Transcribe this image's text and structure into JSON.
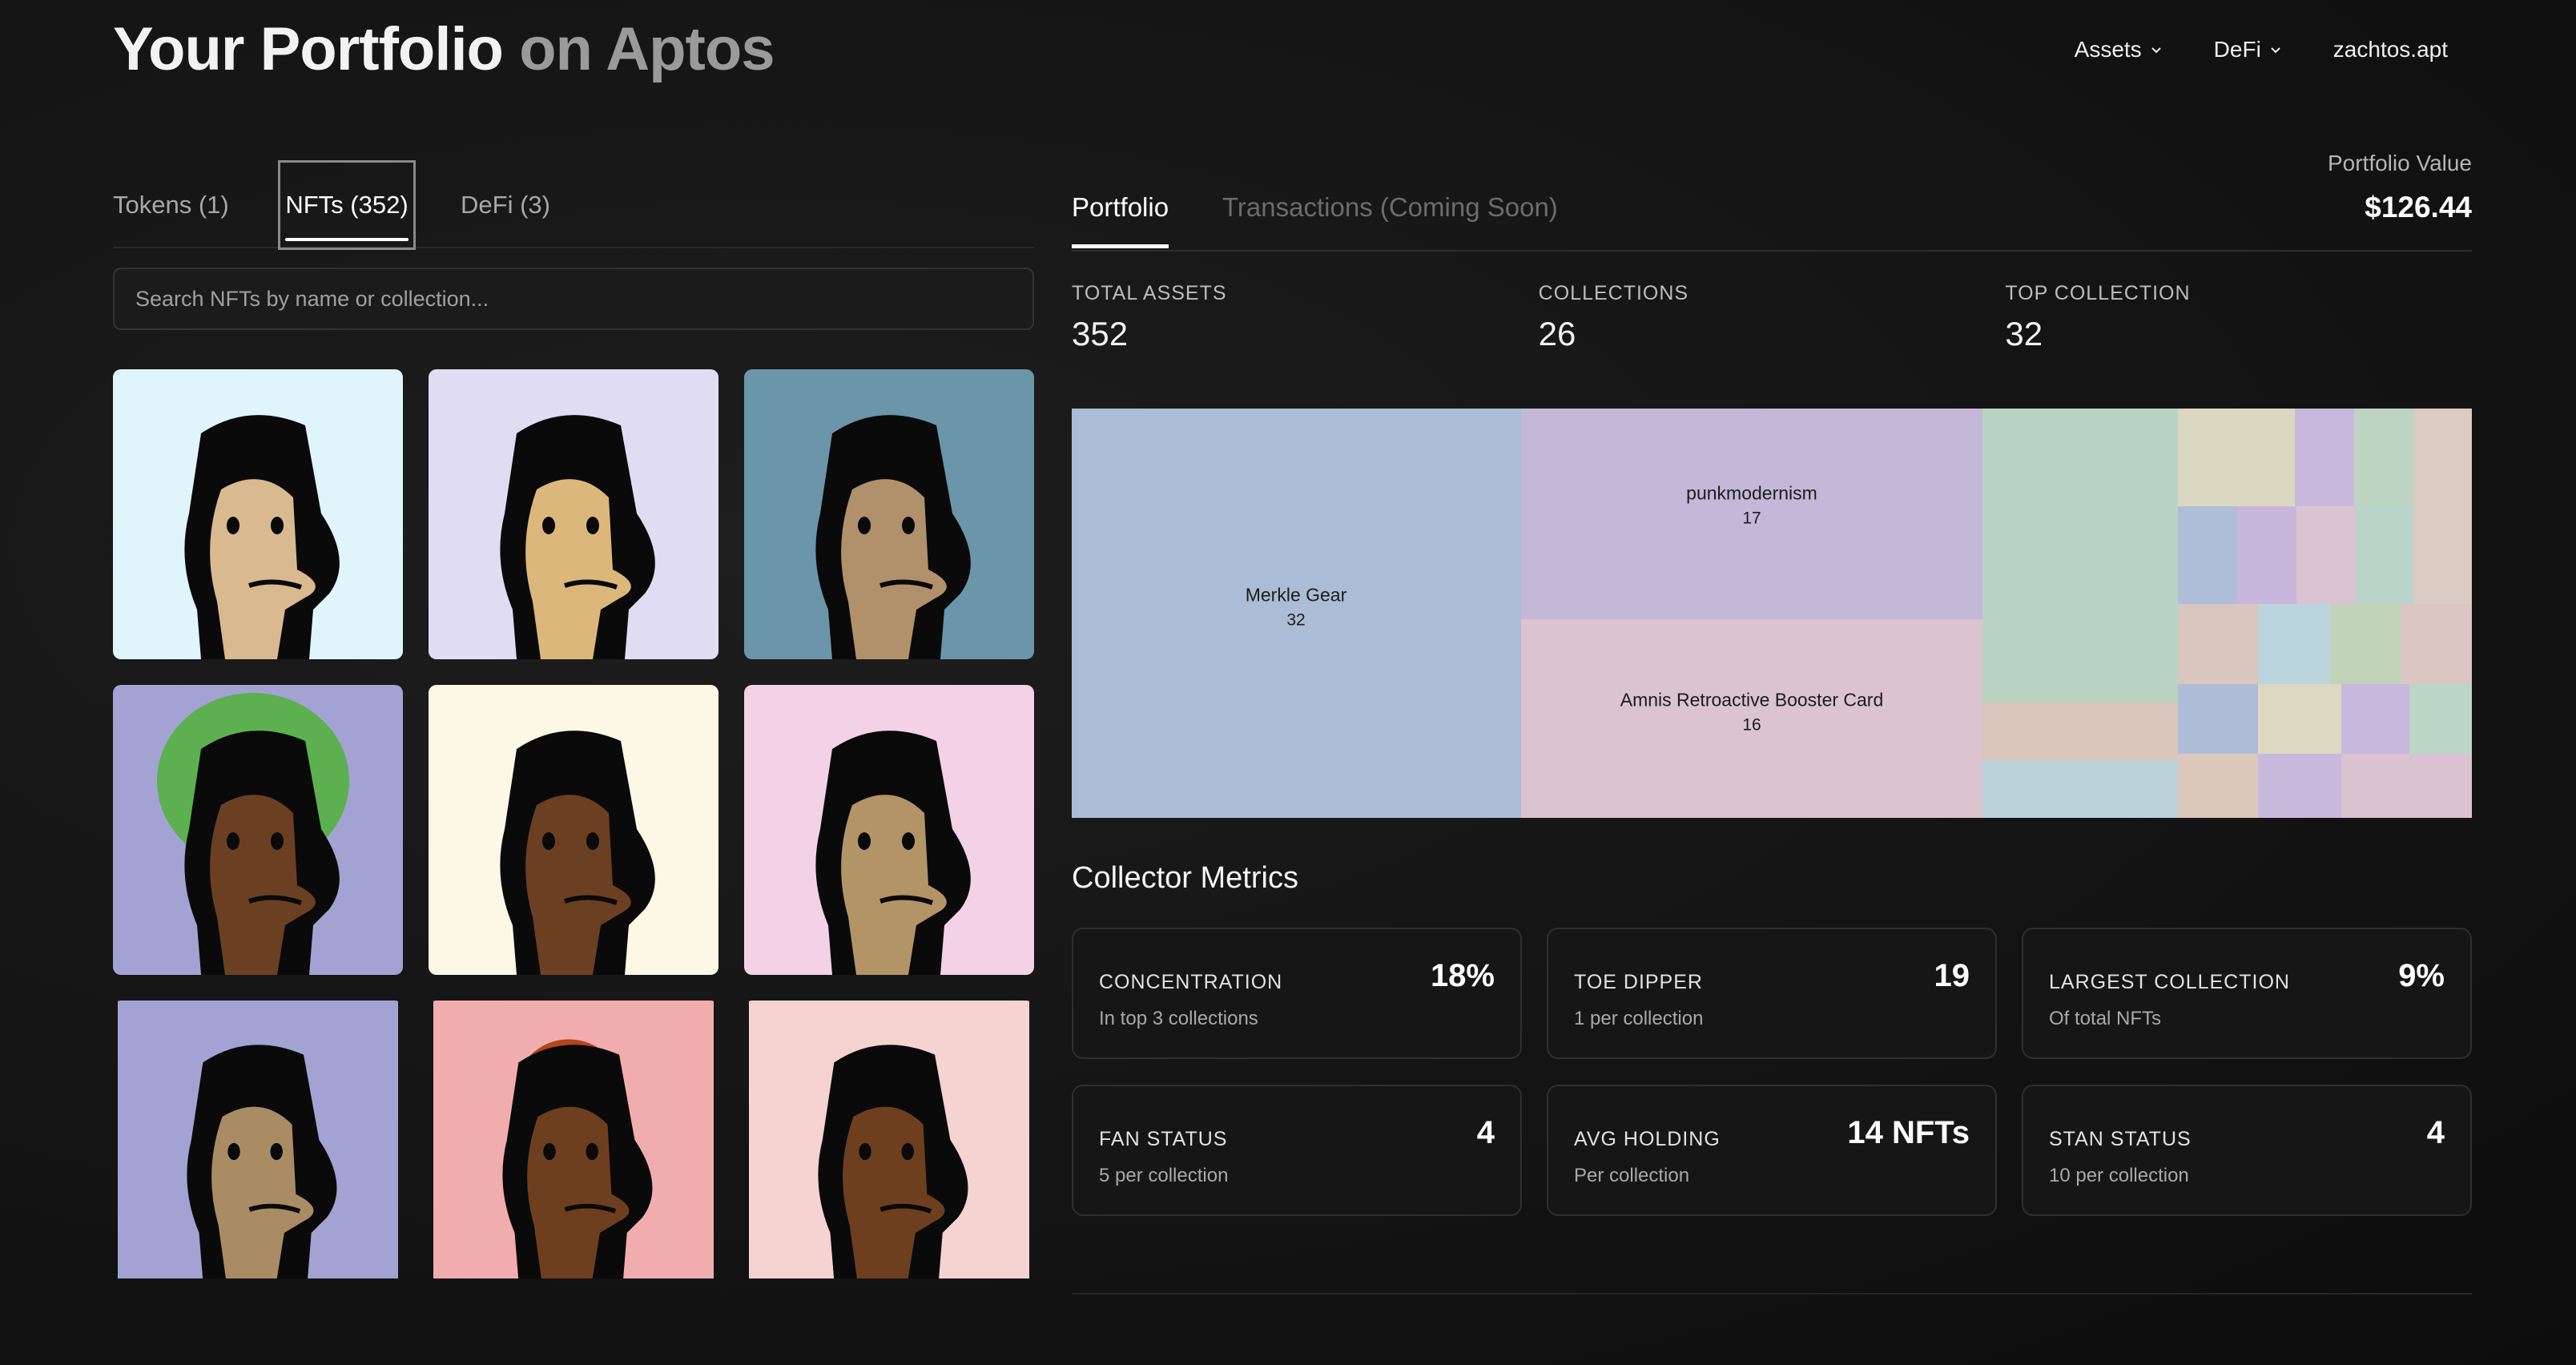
{
  "header": {
    "title_main": "Your Portfolio",
    "title_sub": "on Aptos"
  },
  "nav": {
    "assets": "Assets",
    "defi": "DeFi",
    "account": "zachtos.apt"
  },
  "left_tabs": [
    {
      "label": "Tokens (1)"
    },
    {
      "label": "NFTs (352)",
      "active": true
    },
    {
      "label": "DeFi (3)"
    }
  ],
  "search": {
    "placeholder": "Search NFTs by name or collection..."
  },
  "nfts": [
    {
      "bg": "#dff4fb"
    },
    {
      "bg": "#e0ddf3"
    },
    {
      "bg": "#6b95a8"
    },
    {
      "bg": "#a2a3d3"
    },
    {
      "bg": "#fdf8e6"
    },
    {
      "bg": "#f3d2e8"
    },
    {
      "bg": "#a2a3d3"
    },
    {
      "bg": "#f1adad"
    },
    {
      "bg": "#f4d3d0"
    }
  ],
  "right_tabs": {
    "portfolio": "Portfolio",
    "transactions": "Transactions (Coming Soon)"
  },
  "portfolio_value": {
    "label": "Portfolio Value",
    "value": "$126.44"
  },
  "stats": [
    {
      "label": "TOTAL ASSETS",
      "value": "352"
    },
    {
      "label": "COLLECTIONS",
      "value": "26"
    },
    {
      "label": "TOP COLLECTION",
      "value": "32"
    }
  ],
  "treemap": {
    "labeled": [
      {
        "name": "Merkle Gear",
        "count": "32",
        "color": "#abbdd6"
      },
      {
        "name": "punkmodernism",
        "count": "17",
        "color": "#c3b8d8"
      },
      {
        "name": "Amnis Retroactive Booster Card",
        "count": "16",
        "color": "#dbc4cf"
      }
    ],
    "other_colors": [
      "#b9d3c3",
      "#d8c6bc",
      "#bad2d8",
      "#dad8c0",
      "#c8b9dc",
      "#bdd4c3",
      "#dbcbc2",
      "#aebed8",
      "#c8b6dc",
      "#dbc3d1",
      "#b9d4c8",
      "#d8c6bf",
      "#bad5dc",
      "#c1d4b8",
      "#dbc6c3",
      "#aebcd8",
      "#dcd8c2",
      "#c7b8dc",
      "#bcd6c8",
      "#dbc8bb",
      "#c8b8dc",
      "#d9c3d0",
      "#bed7dc"
    ]
  },
  "collector_metrics": {
    "title": "Collector Metrics",
    "cards": [
      {
        "label": "CONCENTRATION",
        "sub": "In top 3 collections",
        "value": "18%"
      },
      {
        "label": "TOE DIPPER",
        "sub": "1 per collection",
        "value": "19"
      },
      {
        "label": "LARGEST COLLECTION",
        "sub": "Of total NFTs",
        "value": "9%"
      },
      {
        "label": "FAN STATUS",
        "sub": "5 per collection",
        "value": "4"
      },
      {
        "label": "AVG HOLDING",
        "sub": "Per collection",
        "value": "14 NFTs"
      },
      {
        "label": "STAN STATUS",
        "sub": "10 per collection",
        "value": "4"
      }
    ]
  }
}
